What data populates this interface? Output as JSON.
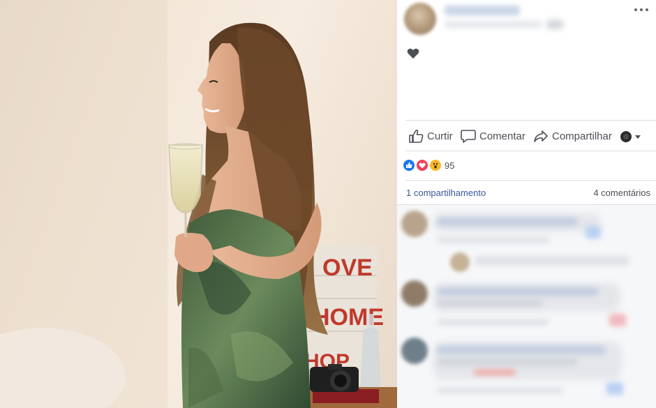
{
  "photo": {
    "sign_words": [
      "OVE",
      "HOME",
      "HOP"
    ]
  },
  "header": {
    "more_icon": "more-horizontal-icon",
    "audience_icon": "heart-icon"
  },
  "actions": {
    "like_label": "Curtir",
    "comment_label": "Comentar",
    "share_label": "Compartilhar",
    "like_icon": "thumbs-up-icon",
    "comment_icon": "comment-bubble-icon",
    "share_icon": "share-arrow-icon",
    "page_switch_icon": "page-avatar-dropdown-icon"
  },
  "reactions": {
    "types": [
      "like",
      "love",
      "wow"
    ],
    "count": "95",
    "colors": {
      "like": "#1877f2",
      "love": "#f33e58",
      "wow": "#f7b928"
    }
  },
  "stats": {
    "shares": "1 compartilhamento",
    "comments": "4 comentários"
  },
  "colors": {
    "link": "#385898",
    "text_secondary": "#4b4f56",
    "divider": "#dadde1"
  }
}
